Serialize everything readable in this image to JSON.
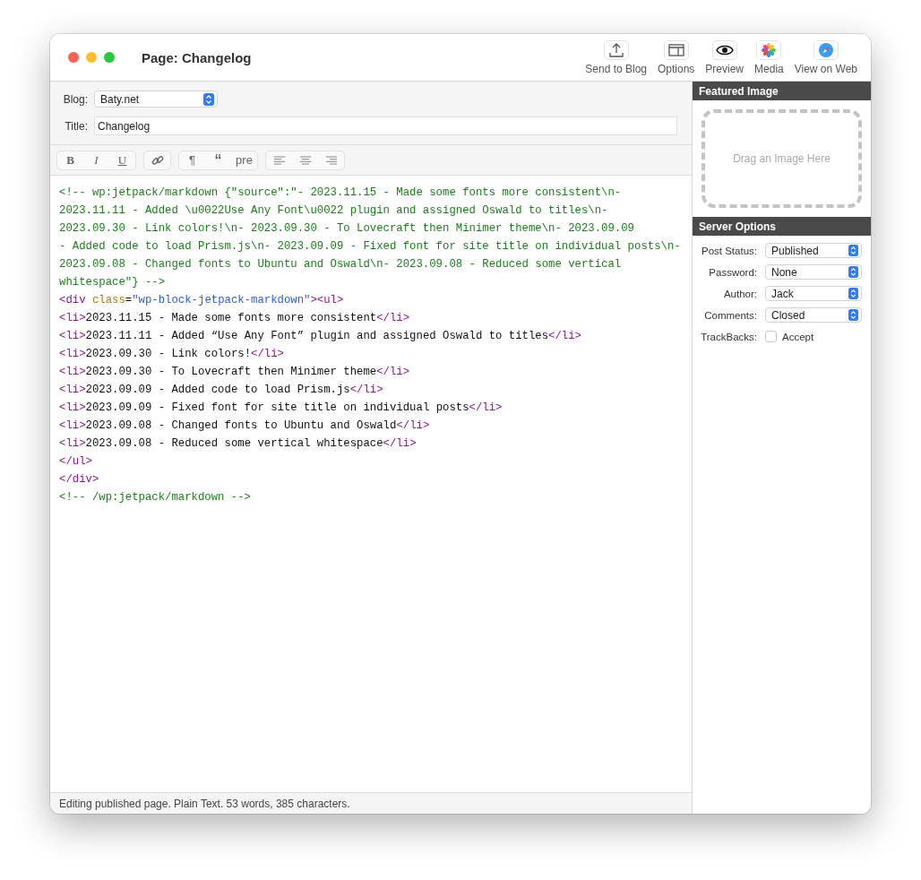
{
  "window": {
    "title": "Page: Changelog"
  },
  "toolbar": [
    {
      "label": "Send to Blog",
      "kind": "upload"
    },
    {
      "label": "Options",
      "kind": "panel"
    },
    {
      "label": "Preview",
      "kind": "eye"
    },
    {
      "label": "Media",
      "kind": "flower"
    },
    {
      "label": "View on Web",
      "kind": "compass"
    }
  ],
  "blog": {
    "label": "Blog:",
    "value": "Baty.net"
  },
  "title_field": {
    "label": "Title:",
    "value": "Changelog"
  },
  "format_groups": [
    [
      {
        "label": "B",
        "kind": "bold"
      },
      {
        "label": "I",
        "kind": "italic"
      },
      {
        "label": "U",
        "kind": "underline"
      }
    ],
    [
      {
        "kind": "link"
      }
    ],
    [
      {
        "label": "¶",
        "kind": "text"
      },
      {
        "label": "“",
        "kind": "quote"
      },
      {
        "label": "pre",
        "kind": "text"
      }
    ],
    [
      {
        "kind": "align-left"
      },
      {
        "kind": "align-center"
      },
      {
        "kind": "align-right"
      }
    ]
  ],
  "editor_lines": [
    [
      {
        "kind": "comment",
        "text": "<!-- wp:jetpack/markdown {\"source\":\"- 2023.11.15 - Made some fonts more consistent\\n-"
      }
    ],
    [
      {
        "kind": "comment",
        "text": "2023.11.11 - Added \\u0022Use Any Font\\u0022 plugin and assigned Oswald to titles\\n-"
      }
    ],
    [
      {
        "kind": "comment",
        "text": "2023.09.30 - Link colors!\\n- 2023.09.30 - To Lovecraft then Minimer theme\\n- 2023.09.09"
      }
    ],
    [
      {
        "kind": "comment",
        "text": "- Added code to load Prism.js\\n- 2023.09.09 - Fixed font for site title on individual posts\\n-"
      }
    ],
    [
      {
        "kind": "comment",
        "text": "2023.09.08 - Changed fonts to Ubuntu and Oswald\\n- 2023.09.08 - Reduced some vertical"
      }
    ],
    [
      {
        "kind": "comment",
        "text": "whitespace\"} -->"
      }
    ],
    [
      {
        "kind": "tag",
        "text": "<div"
      },
      {
        "kind": "attr",
        "text": " class"
      },
      {
        "kind": "text",
        "text": "="
      },
      {
        "kind": "string",
        "text": "\"wp-block-jetpack-markdown\""
      },
      {
        "kind": "tag",
        "text": "><ul>"
      }
    ],
    [
      {
        "kind": "tag",
        "text": "<li>"
      },
      {
        "kind": "text",
        "text": "2023.11.15 - Made some fonts more consistent"
      },
      {
        "kind": "tag",
        "text": "</li>"
      }
    ],
    [
      {
        "kind": "tag",
        "text": "<li>"
      },
      {
        "kind": "text",
        "text": "2023.11.11 - Added “Use Any Font” plugin and assigned Oswald to titles"
      },
      {
        "kind": "tag",
        "text": "</li>"
      }
    ],
    [
      {
        "kind": "tag",
        "text": "<li>"
      },
      {
        "kind": "text",
        "text": "2023.09.30 - Link colors!"
      },
      {
        "kind": "tag",
        "text": "</li>"
      }
    ],
    [
      {
        "kind": "tag",
        "text": "<li>"
      },
      {
        "kind": "text",
        "text": "2023.09.30 - To Lovecraft then Minimer theme"
      },
      {
        "kind": "tag",
        "text": "</li>"
      }
    ],
    [
      {
        "kind": "tag",
        "text": "<li>"
      },
      {
        "kind": "text",
        "text": "2023.09.09 - Added code to load Prism.js"
      },
      {
        "kind": "tag",
        "text": "</li>"
      }
    ],
    [
      {
        "kind": "tag",
        "text": "<li>"
      },
      {
        "kind": "text",
        "text": "2023.09.09 - Fixed font for site title on individual posts"
      },
      {
        "kind": "tag",
        "text": "</li>"
      }
    ],
    [
      {
        "kind": "tag",
        "text": "<li>"
      },
      {
        "kind": "text",
        "text": "2023.09.08 - Changed fonts to Ubuntu and Oswald"
      },
      {
        "kind": "tag",
        "text": "</li>"
      }
    ],
    [
      {
        "kind": "tag",
        "text": "<li>"
      },
      {
        "kind": "text",
        "text": "2023.09.08 - Reduced some vertical whitespace"
      },
      {
        "kind": "tag",
        "text": "</li>"
      }
    ],
    [
      {
        "kind": "tag",
        "text": "</ul>"
      }
    ],
    [
      {
        "kind": "tag",
        "text": "</div>"
      }
    ],
    [
      {
        "kind": "comment",
        "text": "<!-- /wp:jetpack/markdown -->"
      }
    ]
  ],
  "status_bar": "Editing published page. Plain Text. 53 words, 385 characters.",
  "featured_image": {
    "heading": "Featured Image",
    "placeholder": "Drag an Image Here"
  },
  "server_options": {
    "heading": "Server Options",
    "selects": [
      {
        "label": "Post Status:",
        "value": "Published"
      },
      {
        "label": "Password:",
        "value": "None"
      },
      {
        "label": "Author:",
        "value": "Jack"
      },
      {
        "label": "Comments:",
        "value": "Closed"
      }
    ],
    "trackbacks": {
      "label": "TrackBacks:",
      "option": "Accept",
      "checked": false
    }
  }
}
